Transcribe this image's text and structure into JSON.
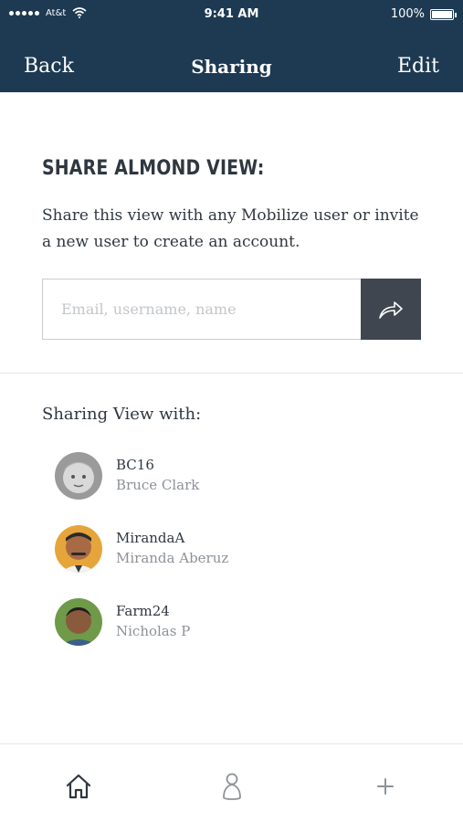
{
  "status_bar": {
    "carrier": "At&t",
    "time": "9:41 AM",
    "battery": "100%"
  },
  "nav": {
    "back_label": "Back",
    "title": "Sharing",
    "edit_label": "Edit"
  },
  "share": {
    "heading": "SHARE ALMOND VIEW:",
    "description": "Share this view with any Mobilize user or invite a new user to create an account.",
    "input_placeholder": "Email, username, name",
    "input_value": "",
    "send_icon": "share-arrow-icon"
  },
  "shared_with": {
    "label": "Sharing View with:",
    "users": [
      {
        "handle": "BC16",
        "name": "Bruce Clark",
        "avatar": "avatar-photo-child"
      },
      {
        "handle": "MirandaA",
        "name": "Miranda Aberuz",
        "avatar": "avatar-photo-man-mustache"
      },
      {
        "handle": "Farm24",
        "name": "Nicholas P",
        "avatar": "avatar-photo-man-outdoor"
      }
    ]
  },
  "tab_bar": {
    "tabs": [
      {
        "icon": "home-icon"
      },
      {
        "icon": "person-icon"
      },
      {
        "icon": "plus-icon"
      }
    ]
  },
  "colors": {
    "nav_background": "#1d3a52",
    "share_button": "#3f4650",
    "text_primary": "#2f3740",
    "text_secondary": "#8d9297"
  }
}
